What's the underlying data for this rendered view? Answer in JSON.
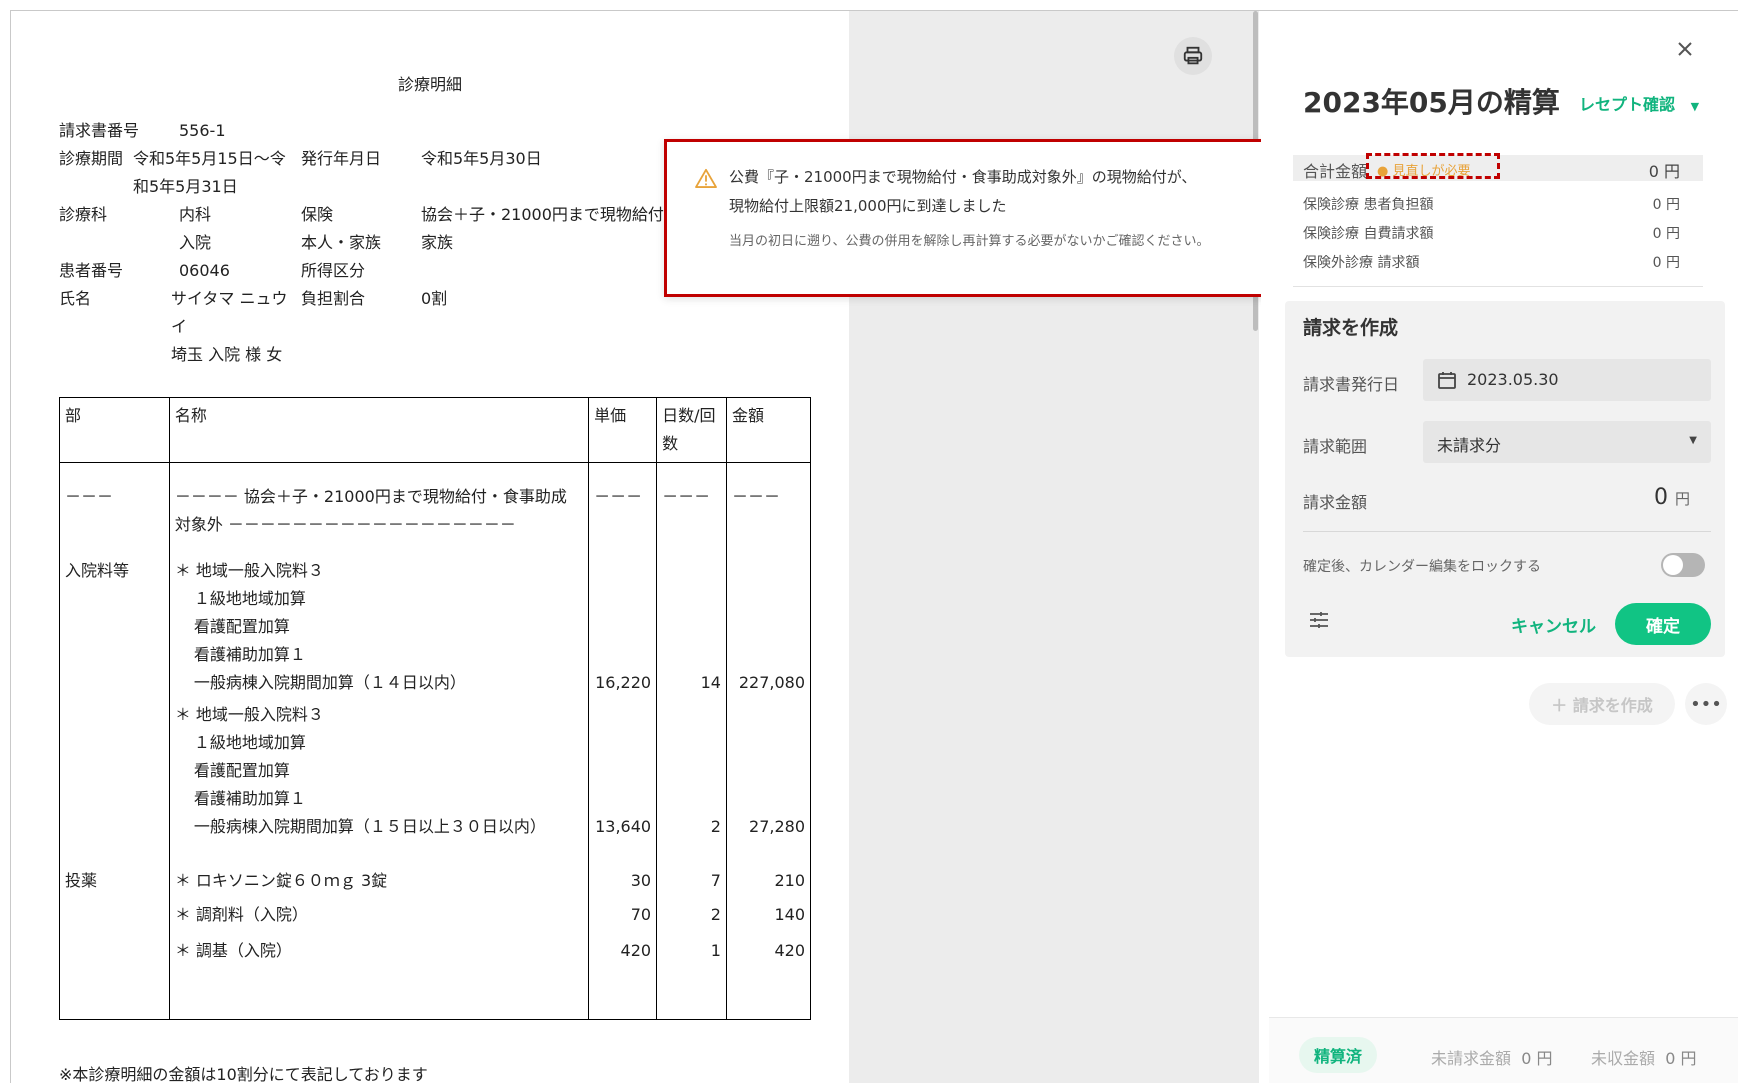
{
  "document": {
    "title": "診療明細",
    "header": {
      "invoice_no_label": "請求書番号",
      "invoice_no": "556-1",
      "period_label": "診療期間",
      "period_line1": "令和5年5月15日～令",
      "period_line2": "和5年5月31日",
      "issue_date_label": "発行年月日",
      "issue_date": "令和5年5月30日",
      "dept_label": "診療科",
      "dept": "内科",
      "dept2": "入院",
      "insurance_label": "保険",
      "insurance_type": "本人・家族",
      "insurance_value": "協会＋子・21000円まで現物給付",
      "insurance_value2": "家族",
      "patient_no_label": "患者番号",
      "patient_no": "06046",
      "income_label": "所得区分",
      "name_label": "氏名",
      "name_line1": "サイタマ ニュウ",
      "name_line2": "イ",
      "name_line3": "埼玉 入院 様 女",
      "burden_label": "負担割合",
      "burden": "0割"
    },
    "table": {
      "headers": [
        "部",
        "名称",
        "単価",
        "日数/回数",
        "金額"
      ],
      "rows": [
        {
          "section": "－－－",
          "name_lines": [
            "－－－－ 協会＋子・21000円まで現物給付・食事助成",
            "対象外 －－－－－－－－－－－－－－－－－－"
          ],
          "unit": "－－－",
          "days": "－－－",
          "amount": "－－－"
        },
        {
          "section": "入院料等",
          "name_lines": [
            "＊ 地域一般入院料３",
            "１級地地域加算",
            "看護配置加算",
            "看護補助加算１",
            "一般病棟入院期間加算（１４日以内）"
          ],
          "unit": "16,220",
          "days": "14",
          "amount": "227,080"
        },
        {
          "section": "",
          "name_lines": [
            "＊ 地域一般入院料３",
            "１級地地域加算",
            "看護配置加算",
            "看護補助加算１",
            "一般病棟入院期間加算（１５日以上３０日以内）"
          ],
          "unit": "13,640",
          "days": "2",
          "amount": "27,280"
        },
        {
          "section": "投薬",
          "name_lines": [
            "＊ ロキソニン錠６０ｍｇ 3錠"
          ],
          "unit": "30",
          "days": "7",
          "amount": "210"
        },
        {
          "section": "",
          "name_lines": [
            "＊ 調剤料（入院）"
          ],
          "unit": "70",
          "days": "2",
          "amount": "140"
        },
        {
          "section": "",
          "name_lines": [
            "＊ 調基（入院）"
          ],
          "unit": "420",
          "days": "1",
          "amount": "420"
        }
      ]
    },
    "footnote": "※本診療明細の金額は10割分にて表記しております"
  },
  "alert": {
    "icon": "warning-triangle-icon",
    "message_line1": "公費『子・21000円まで現物給付・食事助成対象外』の現物給付が、",
    "message_line2": "現物給付上限額21,000円に到達しました",
    "sub_message": "当月の初日に遡り、公費の併用を解除し再計算する必要がないかご確認ください。"
  },
  "panel": {
    "title": "2023年05月の精算",
    "receipt_link": "レセプト確認",
    "total_label": "合計金額",
    "review_badge": "見直しが必要",
    "total_value": "0 円",
    "lines": [
      {
        "label": "保険診療 患者負担額",
        "value": "0 円"
      },
      {
        "label": "保険診療 自費請求額",
        "value": "0 円"
      },
      {
        "label": "保険外診療 請求額",
        "value": "0 円"
      }
    ],
    "create": {
      "title": "請求を作成",
      "issue_date_label": "請求書発行日",
      "issue_date": "2023.05.30",
      "range_label": "請求範囲",
      "range_value": "未請求分",
      "amount_label": "請求金額",
      "amount_value": "0",
      "amount_unit": "円",
      "lock_label": "確定後、カレンダー編集をロックする",
      "cancel": "キャンセル",
      "confirm": "確定"
    },
    "create_invoice_button": "＋ 請求を作成",
    "footer": {
      "status": "精算済",
      "unbilled_label": "未請求金額",
      "unbilled_value": "0 円",
      "uncollected_label": "未収金額",
      "uncollected_value": "0 円"
    }
  },
  "colors": {
    "accent": "#11b47e",
    "alert_border": "#c00000",
    "badge": "#e8a33a"
  }
}
